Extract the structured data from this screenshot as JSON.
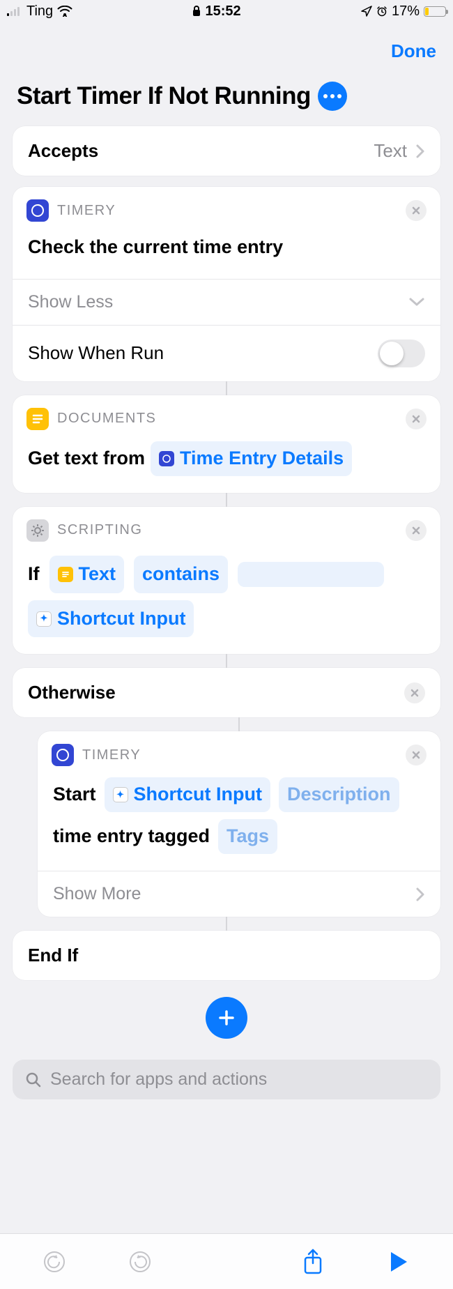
{
  "status_bar": {
    "carrier": "Ting",
    "time": "15:52",
    "battery_text": "17%",
    "battery_pct": 17
  },
  "header": {
    "done": "Done",
    "title": "Start Timer If Not Running"
  },
  "accepts": {
    "label": "Accepts",
    "value": "Text"
  },
  "action1": {
    "app": "TIMERY",
    "title": "Check the current time entry",
    "show_less": "Show Less",
    "show_when_run": "Show When Run"
  },
  "action2": {
    "app": "DOCUMENTS",
    "prefix": "Get text from",
    "token": "Time Entry Details"
  },
  "action3": {
    "app": "SCRIPTING",
    "if_word": "If",
    "token_text": "Text",
    "contains": "contains",
    "shortcut_input": "Shortcut Input"
  },
  "otherwise": {
    "label": "Otherwise"
  },
  "action4": {
    "app": "TIMERY",
    "start": "Start",
    "shortcut_input": "Shortcut Input",
    "description": "Description",
    "tagged": "time entry tagged",
    "tags": "Tags",
    "show_more": "Show More"
  },
  "endif": {
    "label": "End If"
  },
  "search": {
    "placeholder": "Search for apps and actions"
  }
}
